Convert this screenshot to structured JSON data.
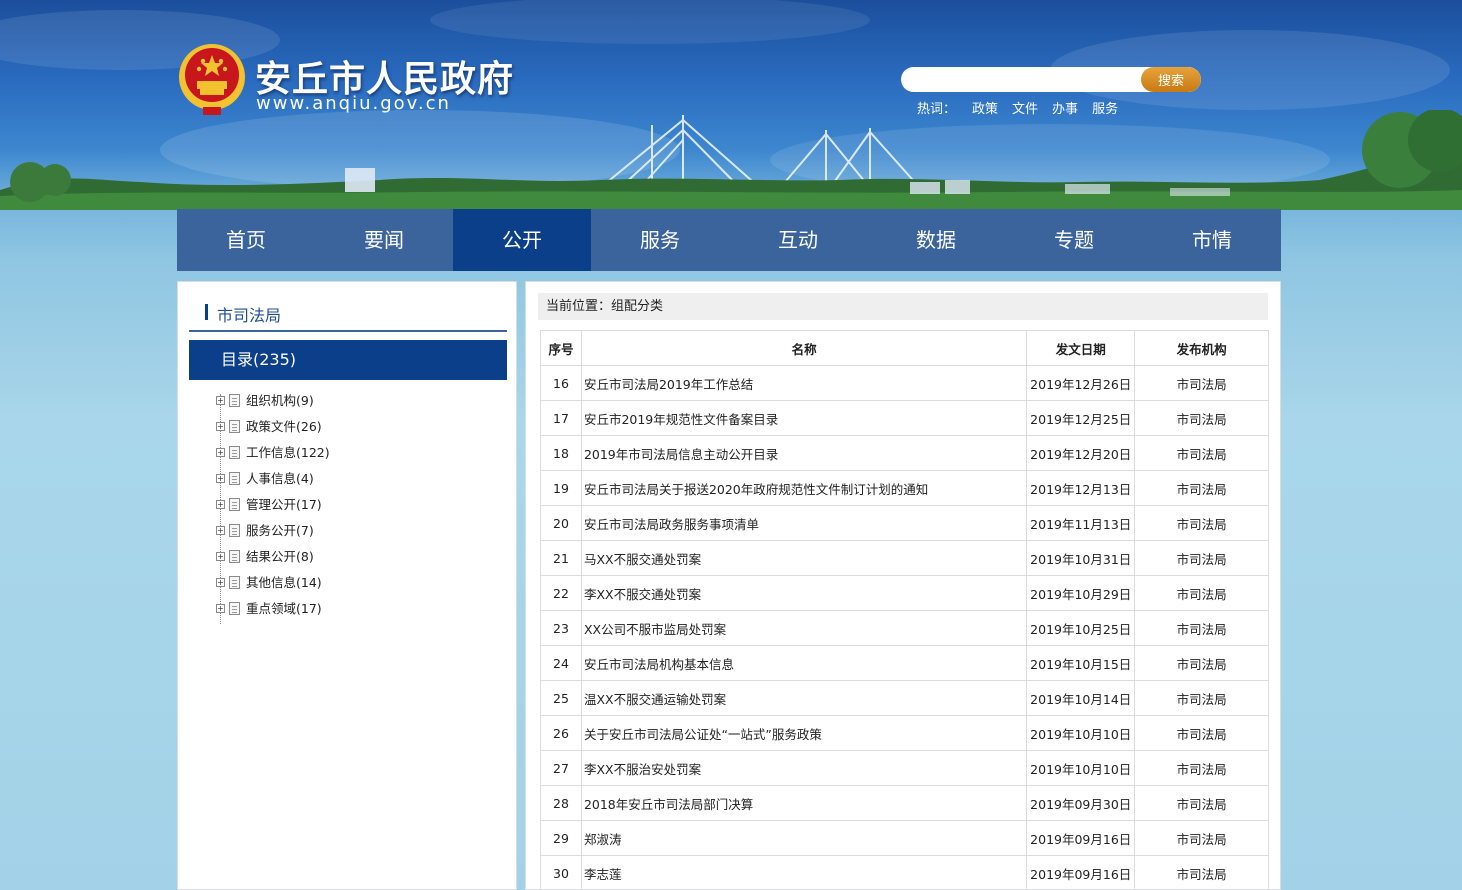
{
  "header": {
    "title": "安丘市人民政府",
    "url": "www.anqiu.gov.cn",
    "search": {
      "placeholder": "",
      "button_label": "搜索"
    },
    "hot_label": "热词：",
    "hot_words": [
      "政策",
      "文件",
      "办事",
      "服务"
    ]
  },
  "nav": {
    "items": [
      "首页",
      "要闻",
      "公开",
      "服务",
      "互动",
      "数据",
      "专题",
      "市情"
    ],
    "active": "公开"
  },
  "sidebar": {
    "heading": "市司法局",
    "catalog_label": "目录(235)",
    "tree": [
      "组织机构(9)",
      "政策文件(26)",
      "工作信息(122)",
      "人事信息(4)",
      "管理公开(17)",
      "服务公开(7)",
      "结果公开(8)",
      "其他信息(14)",
      "重点领域(17)"
    ]
  },
  "main": {
    "breadcrumb": "当前位置：组配分类",
    "columns": [
      "序号",
      "名称",
      "发文日期",
      "发布机构"
    ],
    "rows": [
      {
        "num": "16",
        "name": "安丘市司法局2019年工作总结",
        "date": "2019年12月26日",
        "org": "市司法局"
      },
      {
        "num": "17",
        "name": "安丘市2019年规范性文件备案目录",
        "date": "2019年12月25日",
        "org": "市司法局"
      },
      {
        "num": "18",
        "name": "2019年市司法局信息主动公开目录",
        "date": "2019年12月20日",
        "org": "市司法局"
      },
      {
        "num": "19",
        "name": "安丘市司法局关于报送2020年政府规范性文件制订计划的通知",
        "date": "2019年12月13日",
        "org": "市司法局"
      },
      {
        "num": "20",
        "name": "安丘市司法局政务服务事项清单",
        "date": "2019年11月13日",
        "org": "市司法局"
      },
      {
        "num": "21",
        "name": "马XX不服交通处罚案",
        "date": "2019年10月31日",
        "org": "市司法局"
      },
      {
        "num": "22",
        "name": "李XX不服交通处罚案",
        "date": "2019年10月29日",
        "org": "市司法局"
      },
      {
        "num": "23",
        "name": "XX公司不服市监局处罚案",
        "date": "2019年10月25日",
        "org": "市司法局"
      },
      {
        "num": "24",
        "name": "安丘市司法局机构基本信息",
        "date": "2019年10月15日",
        "org": "市司法局"
      },
      {
        "num": "25",
        "name": "温XX不服交通运输处罚案",
        "date": "2019年10月14日",
        "org": "市司法局"
      },
      {
        "num": "26",
        "name": "关于安丘市司法局公证处“一站式”服务政策",
        "date": "2019年10月10日",
        "org": "市司法局"
      },
      {
        "num": "27",
        "name": "李XX不服治安处罚案",
        "date": "2019年10月10日",
        "org": "市司法局"
      },
      {
        "num": "28",
        "name": "2018年安丘市司法局部门决算",
        "date": "2019年09月30日",
        "org": "市司法局"
      },
      {
        "num": "29",
        "name": "郑淑涛",
        "date": "2019年09月16日",
        "org": "市司法局"
      },
      {
        "num": "30",
        "name": "李志莲",
        "date": "2019年09月16日",
        "org": "市司法局"
      }
    ]
  },
  "colors": {
    "nav_bg": "#3a649b",
    "nav_active": "#0c3f8a",
    "search_button": "#d88a22",
    "emblem_red": "#c8161d",
    "emblem_gold": "#f2c230"
  }
}
